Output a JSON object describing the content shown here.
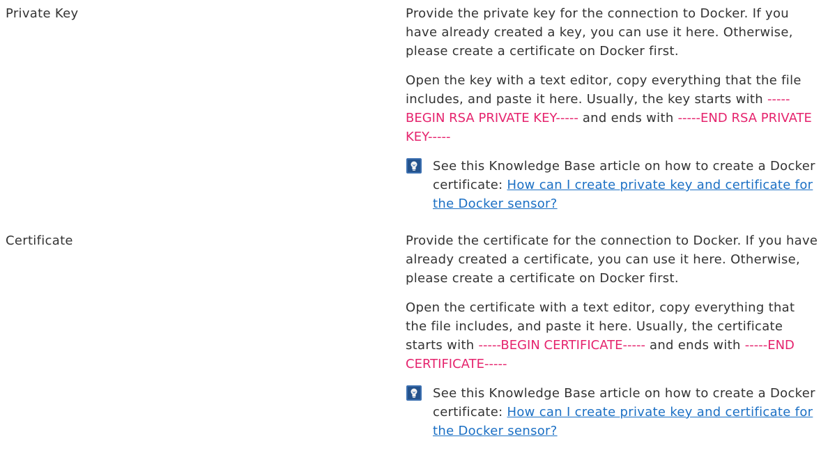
{
  "settings": [
    {
      "label": "Private Key",
      "para1": "Provide the private key for the connection to Docker. If you have already created a key, you can use it here. Otherwise, please create a certificate on Docker first.",
      "para2_before": "Open the key with a text editor, copy everything that the file includes, and paste it here. Usually, the key starts with ",
      "para2_code1": "-----BEGIN RSA PRIVATE KEY-----",
      "para2_middle": " and ends with ",
      "para2_code2": "-----END RSA PRIVATE KEY-----",
      "kb_text": "See this Knowledge Base article on how to create a Docker certificate: ",
      "kb_link": "How can I create private key and certificate for the Docker sensor?"
    },
    {
      "label": "Certificate",
      "para1": "Provide the certificate for the connection to Docker. If you have already created a certificate, you can use it here. Otherwise, please create a certificate on Docker first.",
      "para2_before": "Open the certificate with a text editor, copy everything that the file includes, and paste it here. Usually, the certificate starts with ",
      "para2_code1": "-----BEGIN CERTIFICATE-----",
      "para2_middle": " and ends with ",
      "para2_code2": "-----END CERTIFICATE-----",
      "kb_text": "See this Knowledge Base article on how to create a Docker certificate: ",
      "kb_link": "How can I create private key and certificate for the Docker sensor?"
    }
  ],
  "icons": {
    "kb_icon": "knowledge-base-lightbulb-icon"
  },
  "colors": {
    "text": "#333333",
    "code": "#e5236d",
    "link": "#1a6fc4",
    "icon_bg": "#3b6fb0"
  }
}
